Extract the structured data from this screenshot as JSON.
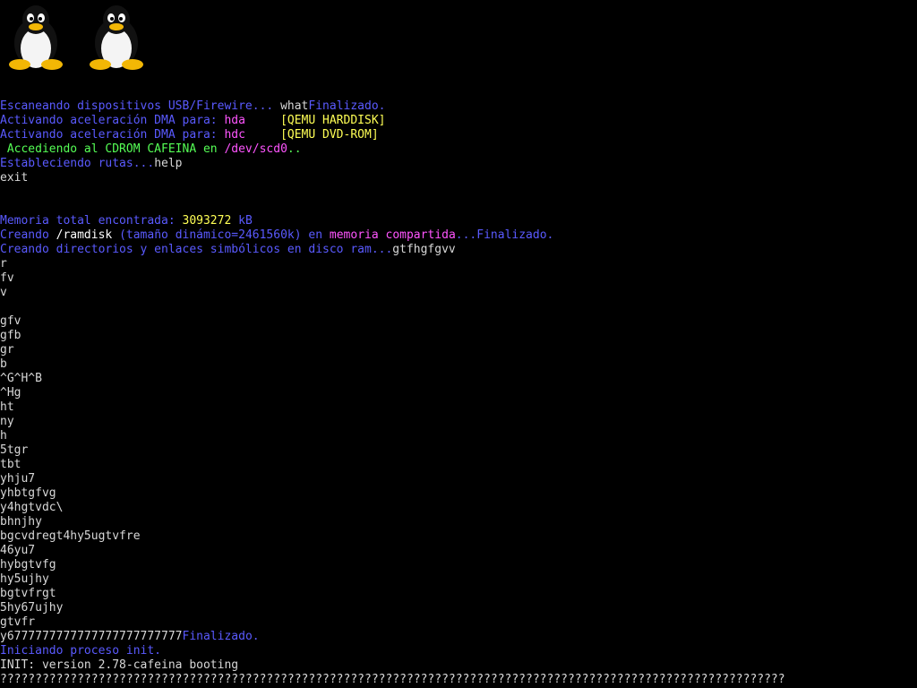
{
  "colors": {
    "background": "#000000",
    "default": "#d8d8d8",
    "blue": "#5a5aff",
    "magenta": "#ff55ff",
    "yellow": "#ffff55",
    "green": "#55ff55",
    "white": "#ffffff"
  },
  "logos": [
    {
      "icon": "tux-penguin-icon"
    },
    {
      "icon": "tux-penguin-icon"
    }
  ],
  "console_lines": [
    [
      {
        "text": "Escaneando dispositivos USB/Firewire... ",
        "color": "blue"
      },
      {
        "text": "what",
        "color": "default"
      },
      {
        "text": "Finalizado.",
        "color": "blue"
      }
    ],
    [
      {
        "text": "Activando aceleración DMA para: ",
        "color": "blue"
      },
      {
        "text": "hda",
        "color": "magenta"
      },
      {
        "text": "     [QEMU HARDDISK]",
        "color": "yellow"
      }
    ],
    [
      {
        "text": "Activando aceleración DMA para: ",
        "color": "blue"
      },
      {
        "text": "hdc",
        "color": "magenta"
      },
      {
        "text": "     [QEMU DVD-ROM]",
        "color": "yellow"
      }
    ],
    [
      {
        "text": " Accediendo al CDROM CAFEINA en ",
        "color": "green"
      },
      {
        "text": "/dev/scd0",
        "color": "magenta"
      },
      {
        "text": "..",
        "color": "green"
      }
    ],
    [
      {
        "text": "Estableciendo rutas...",
        "color": "blue"
      },
      {
        "text": "help",
        "color": "default"
      }
    ],
    [
      {
        "text": "exit",
        "color": "default"
      }
    ],
    [],
    [],
    [
      {
        "text": "Memoria total encontrada: ",
        "color": "blue"
      },
      {
        "text": "3093272",
        "color": "yellow"
      },
      {
        "text": " kB",
        "color": "blue"
      }
    ],
    [
      {
        "text": "Creando ",
        "color": "blue"
      },
      {
        "text": "/ramdisk",
        "color": "white"
      },
      {
        "text": " (tamaño dinámico=2461560k) en ",
        "color": "blue"
      },
      {
        "text": "memoria compartida",
        "color": "magenta"
      },
      {
        "text": "...Finalizado.",
        "color": "blue"
      }
    ],
    [
      {
        "text": "Creando directorios y enlaces simbólicos en disco ram...",
        "color": "blue"
      },
      {
        "text": "gtfhgfgvv",
        "color": "default"
      }
    ],
    [
      {
        "text": "r",
        "color": "default"
      }
    ],
    [
      {
        "text": "fv",
        "color": "default"
      }
    ],
    [
      {
        "text": "v",
        "color": "default"
      }
    ],
    [],
    [
      {
        "text": "gfv",
        "color": "default"
      }
    ],
    [
      {
        "text": "gfb",
        "color": "default"
      }
    ],
    [
      {
        "text": "gr",
        "color": "default"
      }
    ],
    [
      {
        "text": "b",
        "color": "default"
      }
    ],
    [
      {
        "text": "^G^H^B",
        "color": "default"
      }
    ],
    [
      {
        "text": "^Hg",
        "color": "default"
      }
    ],
    [
      {
        "text": "ht",
        "color": "default"
      }
    ],
    [
      {
        "text": "ny",
        "color": "default"
      }
    ],
    [
      {
        "text": "h",
        "color": "default"
      }
    ],
    [
      {
        "text": "5tgr",
        "color": "default"
      }
    ],
    [
      {
        "text": "tbt",
        "color": "default"
      }
    ],
    [
      {
        "text": "yhju7",
        "color": "default"
      }
    ],
    [
      {
        "text": "yhbtgfvg",
        "color": "default"
      }
    ],
    [
      {
        "text": "y4hgtvdc\\",
        "color": "default"
      }
    ],
    [
      {
        "text": "bhnjhy",
        "color": "default"
      }
    ],
    [
      {
        "text": "bgcvdregt4hy5ugtvfre",
        "color": "default"
      }
    ],
    [
      {
        "text": "46yu7",
        "color": "default"
      }
    ],
    [
      {
        "text": "hybgtvfg",
        "color": "default"
      }
    ],
    [
      {
        "text": "hy5ujhy",
        "color": "default"
      }
    ],
    [
      {
        "text": "bgtvfrgt",
        "color": "default"
      }
    ],
    [
      {
        "text": "5hy67ujhy",
        "color": "default"
      }
    ],
    [
      {
        "text": "gtvfr",
        "color": "default"
      }
    ],
    [
      {
        "text": "y6777777777777777777777777",
        "color": "default"
      },
      {
        "text": "Finalizado.",
        "color": "blue"
      }
    ],
    [
      {
        "text": "Iniciando proceso init.",
        "color": "blue"
      }
    ],
    [
      {
        "text": "INIT: version 2.78-cafeina booting",
        "color": "default"
      }
    ],
    [
      {
        "text": "????????????????????????????????????????????????????????????????????????????????????????????????????????????????",
        "color": "default"
      }
    ]
  ]
}
